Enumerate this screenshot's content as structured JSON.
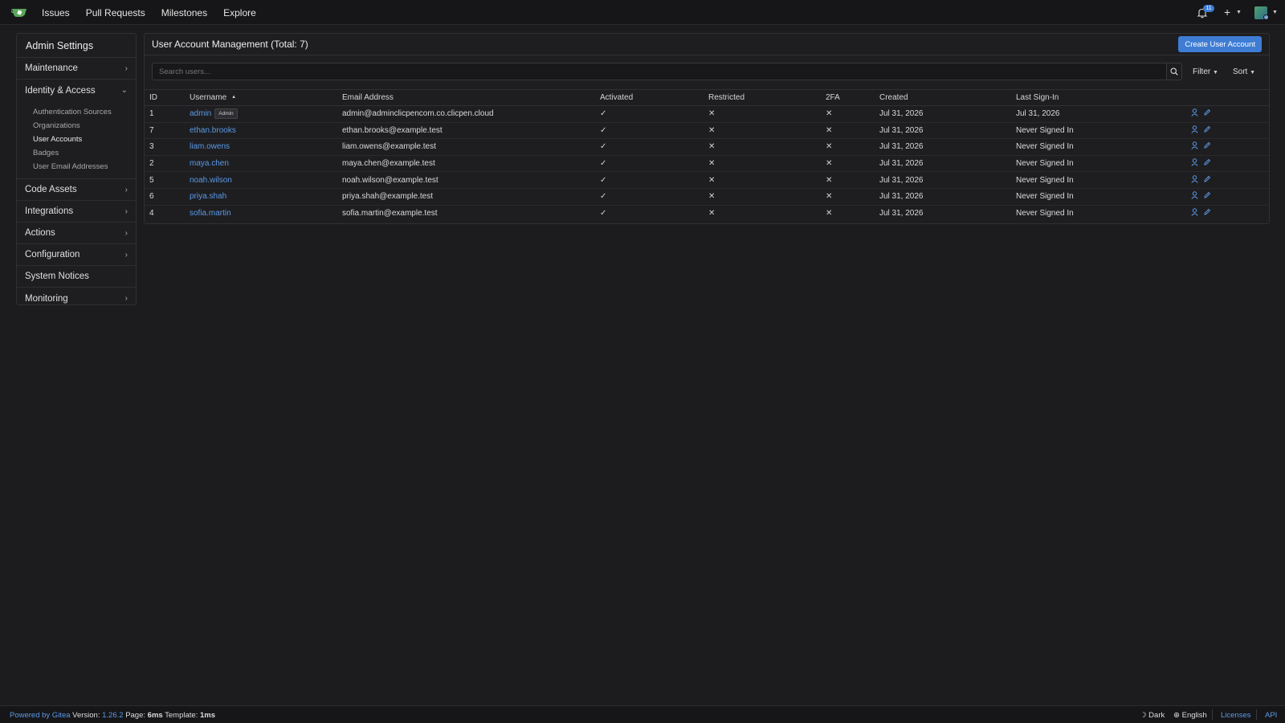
{
  "nav": {
    "items": [
      "Issues",
      "Pull Requests",
      "Milestones",
      "Explore"
    ],
    "notification_count": "11",
    "plus_label": "+"
  },
  "sidebar": {
    "title": "Admin Settings",
    "items": [
      {
        "label": "Maintenance"
      },
      {
        "label": "Identity & Access"
      },
      {
        "label": "Code Assets"
      },
      {
        "label": "Integrations"
      },
      {
        "label": "Actions"
      },
      {
        "label": "Configuration"
      },
      {
        "label": "System Notices"
      },
      {
        "label": "Monitoring"
      }
    ],
    "identity_subitems": [
      "Authentication Sources",
      "Organizations",
      "User Accounts",
      "Badges",
      "User Email Addresses"
    ],
    "active_subitem": "User Accounts"
  },
  "panel": {
    "title": "User Account Management (Total: 7)",
    "create_button": "Create User Account",
    "search_placeholder": "Search users...",
    "filter_label": "Filter",
    "sort_label": "Sort",
    "columns": [
      "ID",
      "Username",
      "Email Address",
      "Activated",
      "Restricted",
      "2FA",
      "Created",
      "Last Sign-In"
    ],
    "admin_badge": "Admin",
    "rows": [
      {
        "id": "1",
        "username": "admin",
        "is_admin": true,
        "email": "admin@adminclicpencom.co.clicpen.cloud",
        "activated": "✓",
        "restricted": "✕",
        "twofa": "✕",
        "created": "Jul 31, 2026",
        "last": "Jul 31, 2026"
      },
      {
        "id": "7",
        "username": "ethan.brooks",
        "is_admin": false,
        "email": "ethan.brooks@example.test",
        "activated": "✓",
        "restricted": "✕",
        "twofa": "✕",
        "created": "Jul 31, 2026",
        "last": "Never Signed In"
      },
      {
        "id": "3",
        "username": "liam.owens",
        "is_admin": false,
        "email": "liam.owens@example.test",
        "activated": "✓",
        "restricted": "✕",
        "twofa": "✕",
        "created": "Jul 31, 2026",
        "last": "Never Signed In"
      },
      {
        "id": "2",
        "username": "maya.chen",
        "is_admin": false,
        "email": "maya.chen@example.test",
        "activated": "✓",
        "restricted": "✕",
        "twofa": "✕",
        "created": "Jul 31, 2026",
        "last": "Never Signed In"
      },
      {
        "id": "5",
        "username": "noah.wilson",
        "is_admin": false,
        "email": "noah.wilson@example.test",
        "activated": "✓",
        "restricted": "✕",
        "twofa": "✕",
        "created": "Jul 31, 2026",
        "last": "Never Signed In"
      },
      {
        "id": "6",
        "username": "priya.shah",
        "is_admin": false,
        "email": "priya.shah@example.test",
        "activated": "✓",
        "restricted": "✕",
        "twofa": "✕",
        "created": "Jul 31, 2026",
        "last": "Never Signed In"
      },
      {
        "id": "4",
        "username": "sofia.martin",
        "is_admin": false,
        "email": "sofia.martin@example.test",
        "activated": "✓",
        "restricted": "✕",
        "twofa": "✕",
        "created": "Jul 31, 2026",
        "last": "Never Signed In"
      }
    ]
  },
  "footer": {
    "powered": "Powered by Gitea",
    "version_label": "Version:",
    "version": "1.26.2",
    "page_label": "Page:",
    "page_time": "6ms",
    "template_label": "Template:",
    "template_time": "1ms",
    "theme": "Dark",
    "language": "English",
    "licenses": "Licenses",
    "api": "API"
  },
  "colors": {
    "accent": "#3f7dd4",
    "link": "#5a9ae6",
    "background": "#1c1c1e"
  }
}
